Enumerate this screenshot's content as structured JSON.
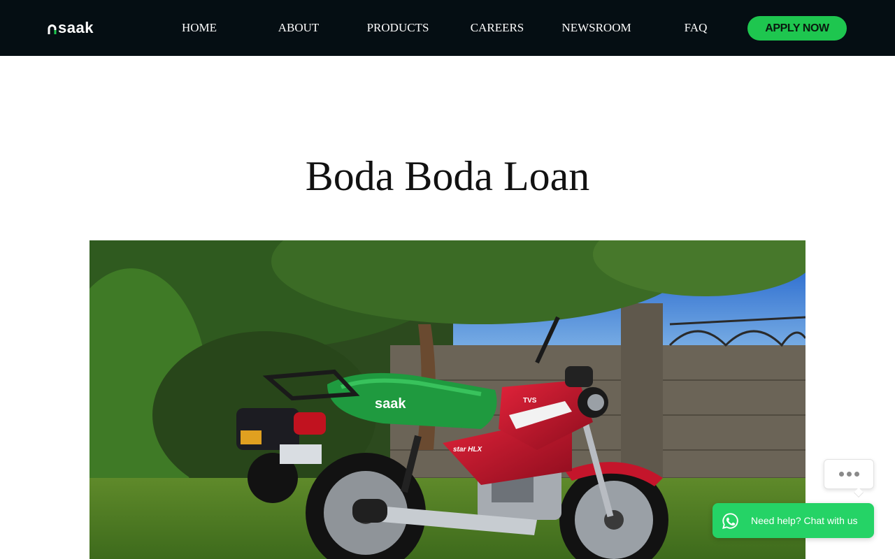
{
  "header": {
    "logo_text": "saak",
    "nav": [
      {
        "label": "HOME"
      },
      {
        "label": "ABOUT"
      },
      {
        "label": "PRODUCTS"
      },
      {
        "label": "CAREERS"
      },
      {
        "label": "NEWSROOM"
      },
      {
        "label": "FAQ"
      }
    ],
    "cta_label": "APPLY NOW"
  },
  "main": {
    "title": "Boda Boda Loan",
    "hero": {
      "seat_logo": "saak",
      "tank_badge": "TVS",
      "model_badge": "star HLX"
    }
  },
  "chat_widget": {
    "label": "Need help? Chat with us",
    "icon": "whatsapp-icon"
  },
  "colors": {
    "header_bg": "#050e13",
    "accent_green": "#1ec64f",
    "whatsapp_green": "#25d366"
  }
}
